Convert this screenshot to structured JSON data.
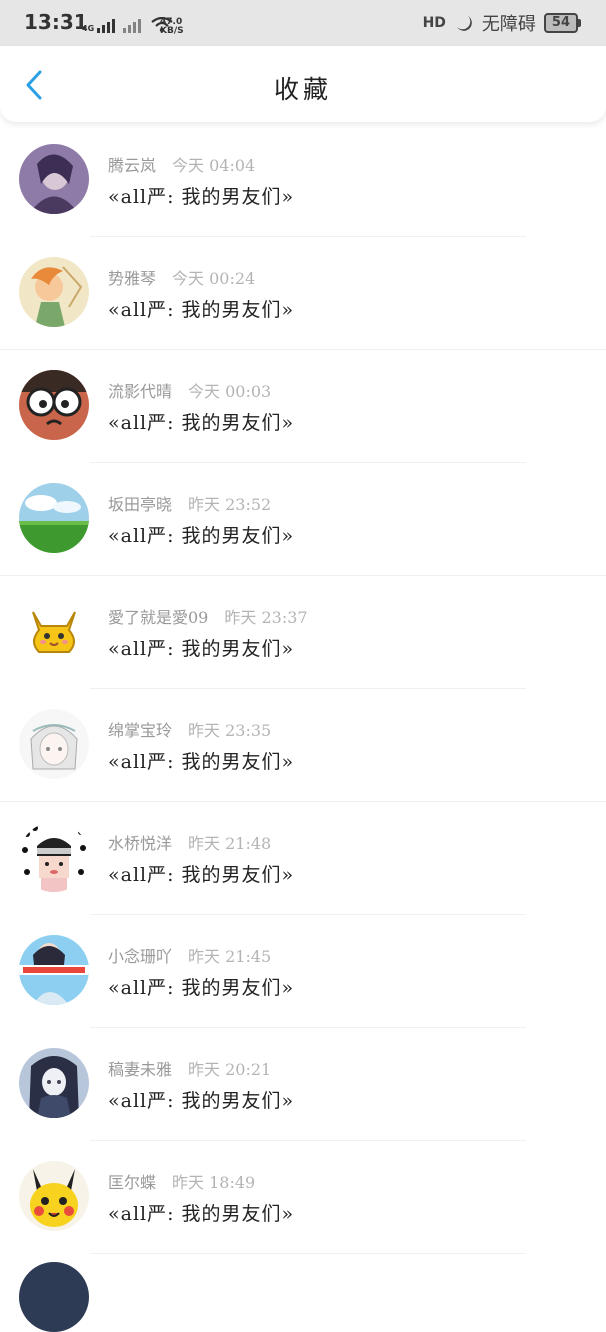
{
  "status_bar": {
    "time": "13:31",
    "network_label": "4G",
    "speed_value": "47.0",
    "speed_unit": "KB/S",
    "hd_label": "HD",
    "accessibility": "无障碍",
    "battery": "54"
  },
  "header": {
    "title": "收藏"
  },
  "items": [
    {
      "name": "腾云岚",
      "time": "今天 04:04",
      "content": "«all严: 我的男友们»"
    },
    {
      "name": "势雅琴",
      "time": "今天 00:24",
      "content": "«all严: 我的男友们»"
    },
    {
      "name": "流影代晴",
      "time": "今天 00:03",
      "content": "«all严: 我的男友们»"
    },
    {
      "name": "坂田亭晓",
      "time": "昨天 23:52",
      "content": "«all严: 我的男友们»"
    },
    {
      "name": "愛了就是愛09",
      "time": "昨天 23:37",
      "content": "«all严: 我的男友们»"
    },
    {
      "name": "绵掌宝玲",
      "time": "昨天 23:35",
      "content": "«all严: 我的男友们»"
    },
    {
      "name": "水桥悦洋",
      "time": "昨天 21:48",
      "content": "«all严: 我的男友们»"
    },
    {
      "name": "小念珊吖",
      "time": "昨天 21:45",
      "content": "«all严: 我的男友们»"
    },
    {
      "name": "稿妻未雅",
      "time": "昨天 20:21",
      "content": "«all严: 我的男友们»"
    },
    {
      "name": "匡尔蝶",
      "time": "昨天 18:49",
      "content": "«all严: 我的男友们»"
    }
  ],
  "colors": {
    "accent": "#2a9fe6",
    "name_text": "#999999",
    "content_text": "#222222"
  }
}
